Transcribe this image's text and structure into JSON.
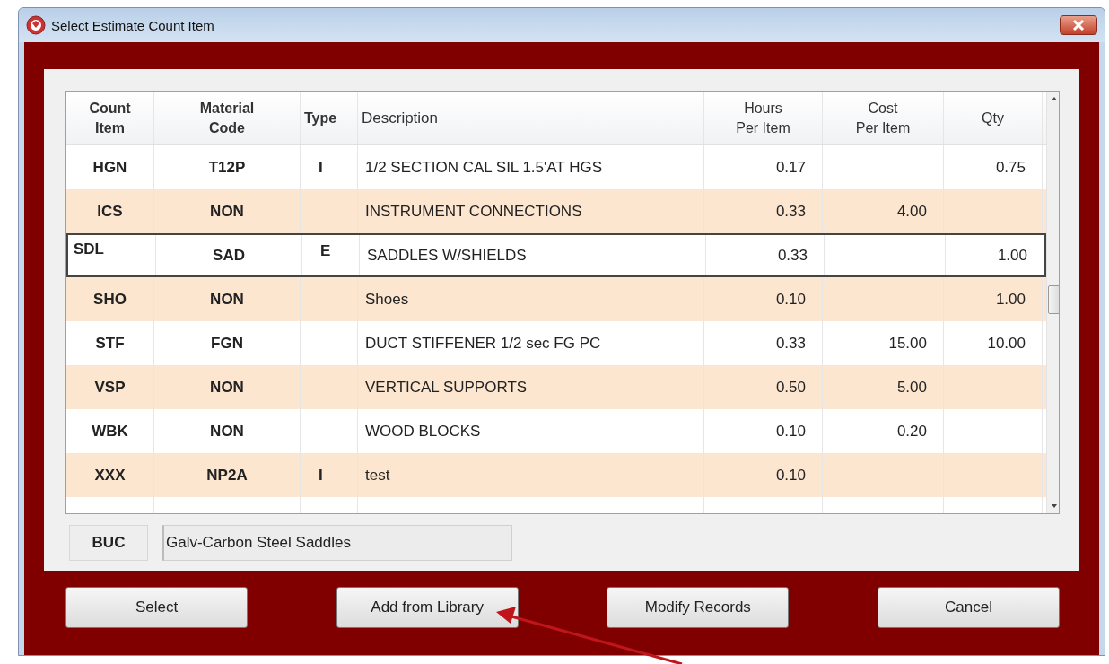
{
  "window": {
    "title": "Select Estimate Count Item"
  },
  "table": {
    "columns": [
      "Count\nItem",
      "Material\nCode",
      "Type",
      "Description",
      "Hours\nPer Item",
      "Cost\nPer Item",
      "Qty"
    ],
    "rows": [
      {
        "count_item": "HGN",
        "material_code": "T12P",
        "type": "I",
        "description": "1/2 SECTION CAL SIL 1.5'AT HGS",
        "hours_per_item": "0.17",
        "qty": "0.75",
        "selected": false
      },
      {
        "count_item": "ICS",
        "material_code": "NON",
        "description": "INSTRUMENT CONNECTIONS",
        "hours_per_item": "0.33",
        "cost_per_item": "4.00",
        "selected": false
      },
      {
        "count_item": "SDL",
        "material_code": "SAD",
        "type": "E",
        "description": "SADDLES W/SHIELDS",
        "hours_per_item": "0.33",
        "qty": "1.00",
        "selected": true
      },
      {
        "count_item": "SHO",
        "material_code": "NON",
        "description": "Shoes",
        "hours_per_item": "0.10",
        "qty": "1.00",
        "selected": false
      },
      {
        "count_item": "STF",
        "material_code": "FGN",
        "description": "DUCT STIFFENER  1/2 sec FG PC",
        "hours_per_item": "0.33",
        "cost_per_item": "15.00",
        "qty": "10.00",
        "selected": false
      },
      {
        "count_item": "VSP",
        "material_code": "NON",
        "description": "VERTICAL SUPPORTS",
        "hours_per_item": "0.50",
        "cost_per_item": "5.00",
        "selected": false
      },
      {
        "count_item": "WBK",
        "material_code": "NON",
        "description": "WOOD BLOCKS",
        "hours_per_item": "0.10",
        "cost_per_item": "0.20",
        "selected": false
      },
      {
        "count_item": "XXX",
        "material_code": "NP2A",
        "type": "I",
        "description": "test",
        "hours_per_item": "0.10",
        "selected": false
      }
    ]
  },
  "detail": {
    "code": "BUC",
    "description": "Galv-Carbon Steel Saddles"
  },
  "buttons": [
    "Select",
    "Add from Library",
    "Modify Records",
    "Cancel"
  ]
}
